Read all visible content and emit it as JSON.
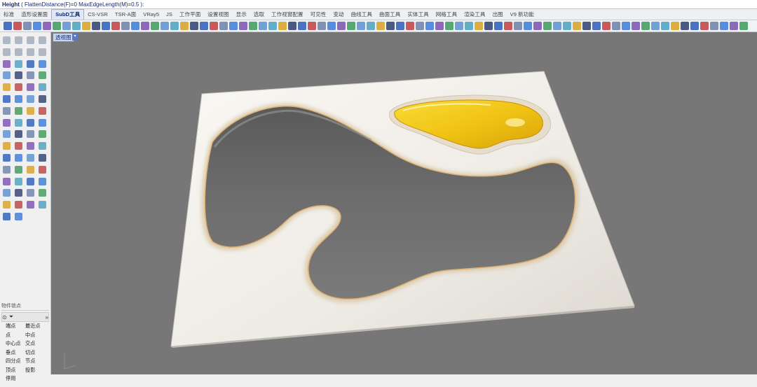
{
  "command_line": {
    "prompt": "Height",
    "options": "( FlattenDistance(F)=0   MaxEdgeLength(M)=0.5 ):"
  },
  "tabs": [
    "标准",
    "造形设置面",
    "SubD工具",
    "CS-VSR",
    "TSR-A面",
    "VRay5",
    "JS",
    "工作平面",
    "设置视图",
    "显示",
    "选取",
    "工作视窗配置",
    "可见性",
    "变动",
    "曲线工具",
    "曲面工具",
    "实体工具",
    "网格工具",
    "渲染工具",
    "出图",
    "V9 新功能"
  ],
  "active_tab": "SubD工具",
  "viewport": {
    "label": "透视图"
  },
  "osnap": {
    "title": "物件锁点",
    "items": [
      "端点",
      "最近点",
      "点",
      "中点",
      "中心点",
      "交点",
      "垂点",
      "切点",
      "四分点",
      "节点",
      "顶点",
      "投影",
      "停用"
    ]
  },
  "colors": {
    "viewport_bg": "#777777",
    "model_white": "#f4f2ee",
    "yellow_pocket": "#f2c41a",
    "active_tab": "#dfe8f8"
  }
}
